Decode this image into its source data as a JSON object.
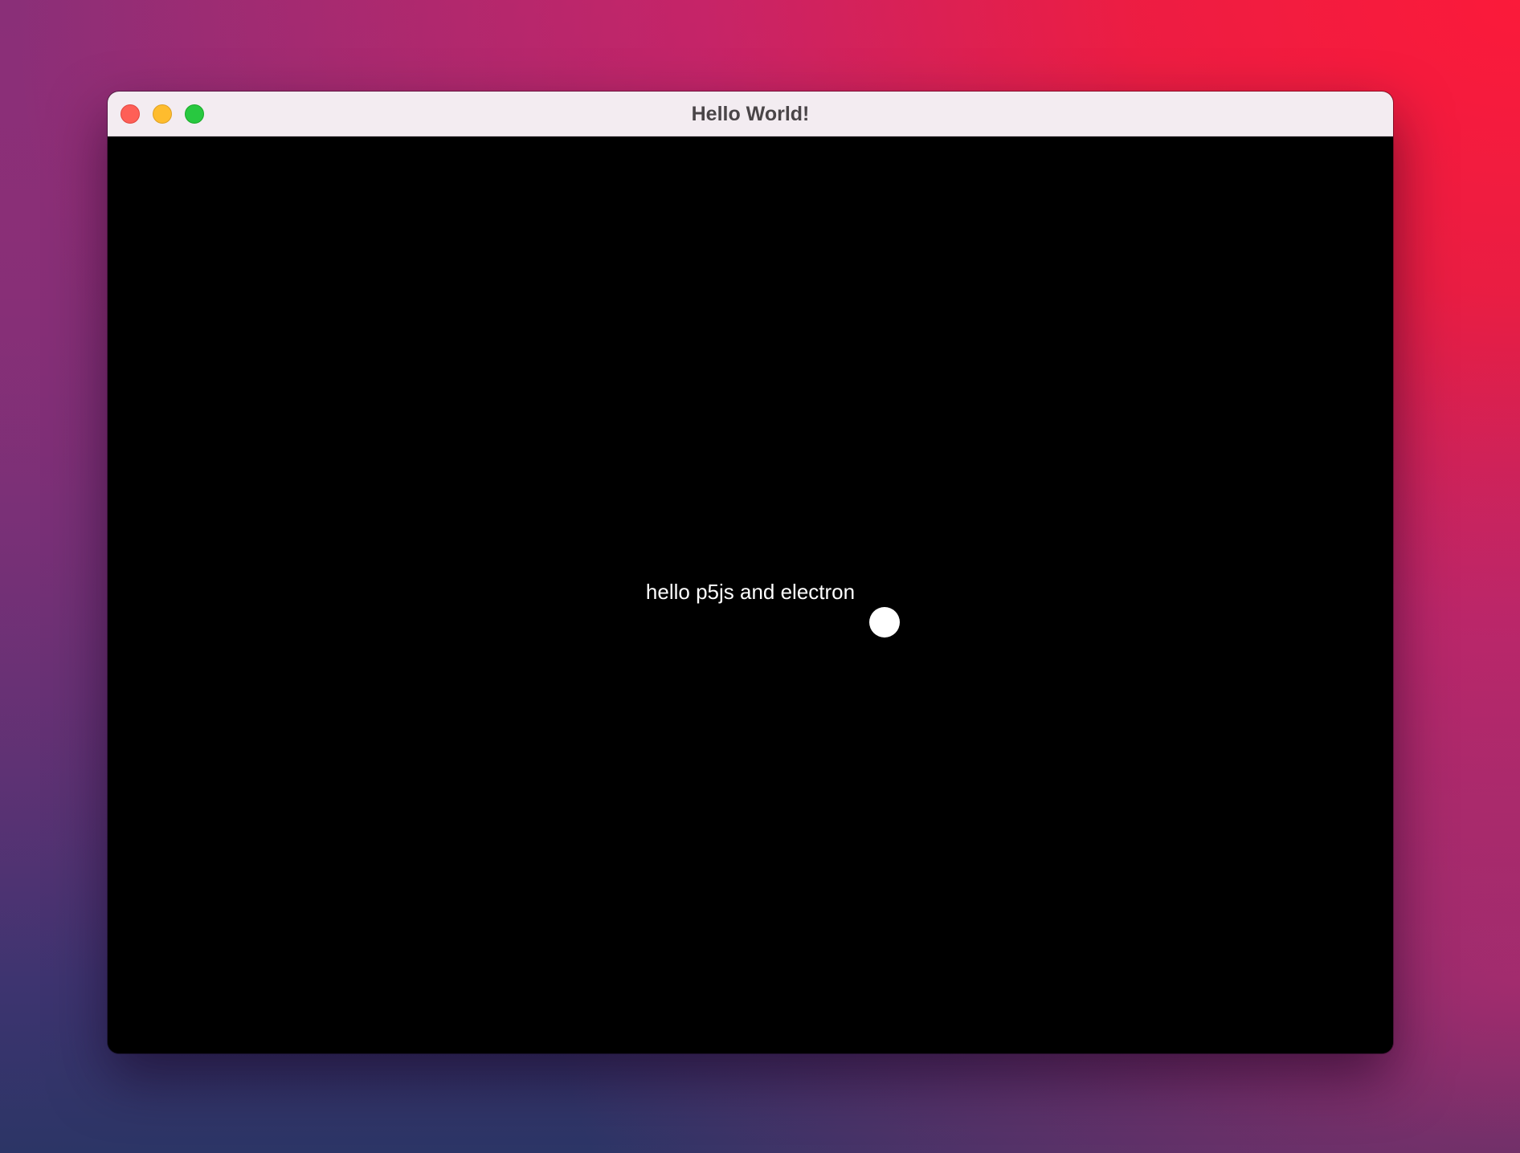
{
  "window": {
    "title": "Hello World!"
  },
  "traffic_lights": {
    "close_color": "#fe5f57",
    "minimize_color": "#febc2e",
    "zoom_color": "#28c840"
  },
  "canvas": {
    "background": "#000000",
    "text": "hello p5js and electron",
    "dot_color": "#ffffff"
  }
}
